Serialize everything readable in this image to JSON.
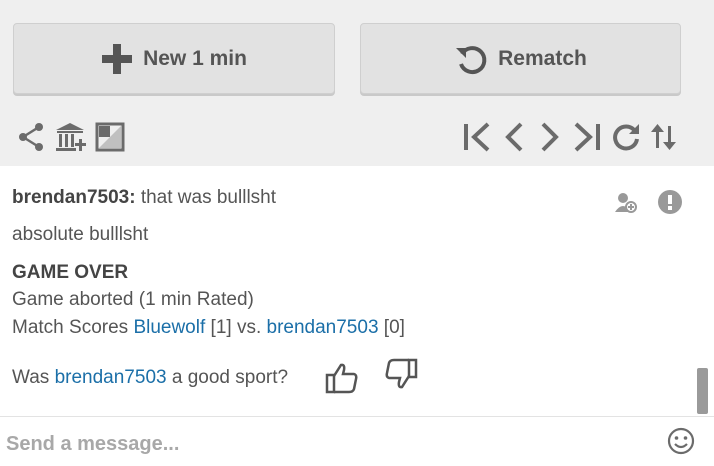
{
  "buttons": {
    "new_game": "New 1 min",
    "rematch": "Rematch"
  },
  "icons": {
    "left_tools": [
      "share-icon",
      "bank-icon",
      "board-flip-icon"
    ],
    "nav": [
      "first-move-icon",
      "prev-move-icon",
      "next-move-icon",
      "last-move-icon",
      "refresh-icon",
      "flip-icon"
    ]
  },
  "chat": {
    "msg1_user": "brendan7503:",
    "msg1_text": "that was bulllsht",
    "msg2_text": "absolute bulllsht",
    "game_over": "GAME OVER",
    "aborted": "Game aborted (1 min Rated)",
    "scores_label": "Match Scores",
    "player1": "Bluewolf",
    "player1_score": "[1]",
    "vs": "vs.",
    "player2": "brendan7503",
    "player2_score": "[0]",
    "sport_prefix": "Was",
    "sport_user": "brendan7503",
    "sport_suffix": "a good sport?"
  },
  "input": {
    "placeholder": "Send a message..."
  },
  "colors": {
    "link": "#1b6fa8",
    "panel_bg": "#efefef",
    "button_bg": "#e2e2e2",
    "icon": "#6b6b6b"
  }
}
